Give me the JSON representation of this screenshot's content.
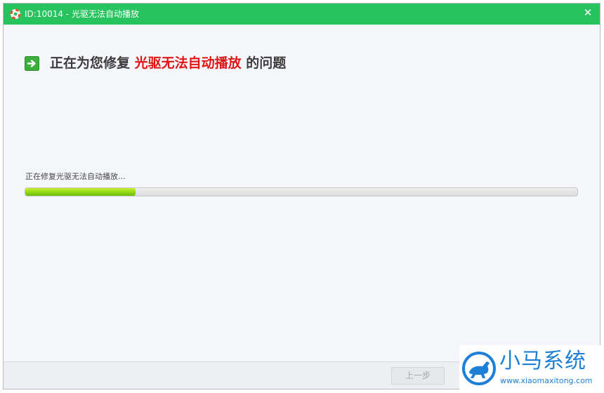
{
  "window": {
    "title": "ID:10014 - 光驱无法自动播放",
    "close_symbol": "✕"
  },
  "heading": {
    "prefix": "正在为您修复 ",
    "highlight": "光驱无法自动播放",
    "suffix": " 的问题",
    "highlight_color": "#e01515"
  },
  "progress": {
    "status_text": "正在修复光驱无法自动播放...",
    "fraction": 0.2
  },
  "footer": {
    "prev_button": "上一步"
  },
  "watermark": {
    "name": "小马系统",
    "url": "www.xiaomaxitong.com"
  },
  "icons": {
    "app": "lifebuoy-icon",
    "heading": "arrow-right-icon",
    "close": "close-icon",
    "watermark": "horse-logo-icon"
  },
  "colors": {
    "titlebar": "#27c35e",
    "progress": "#8fd813",
    "watermark": "#1d7fd6"
  }
}
